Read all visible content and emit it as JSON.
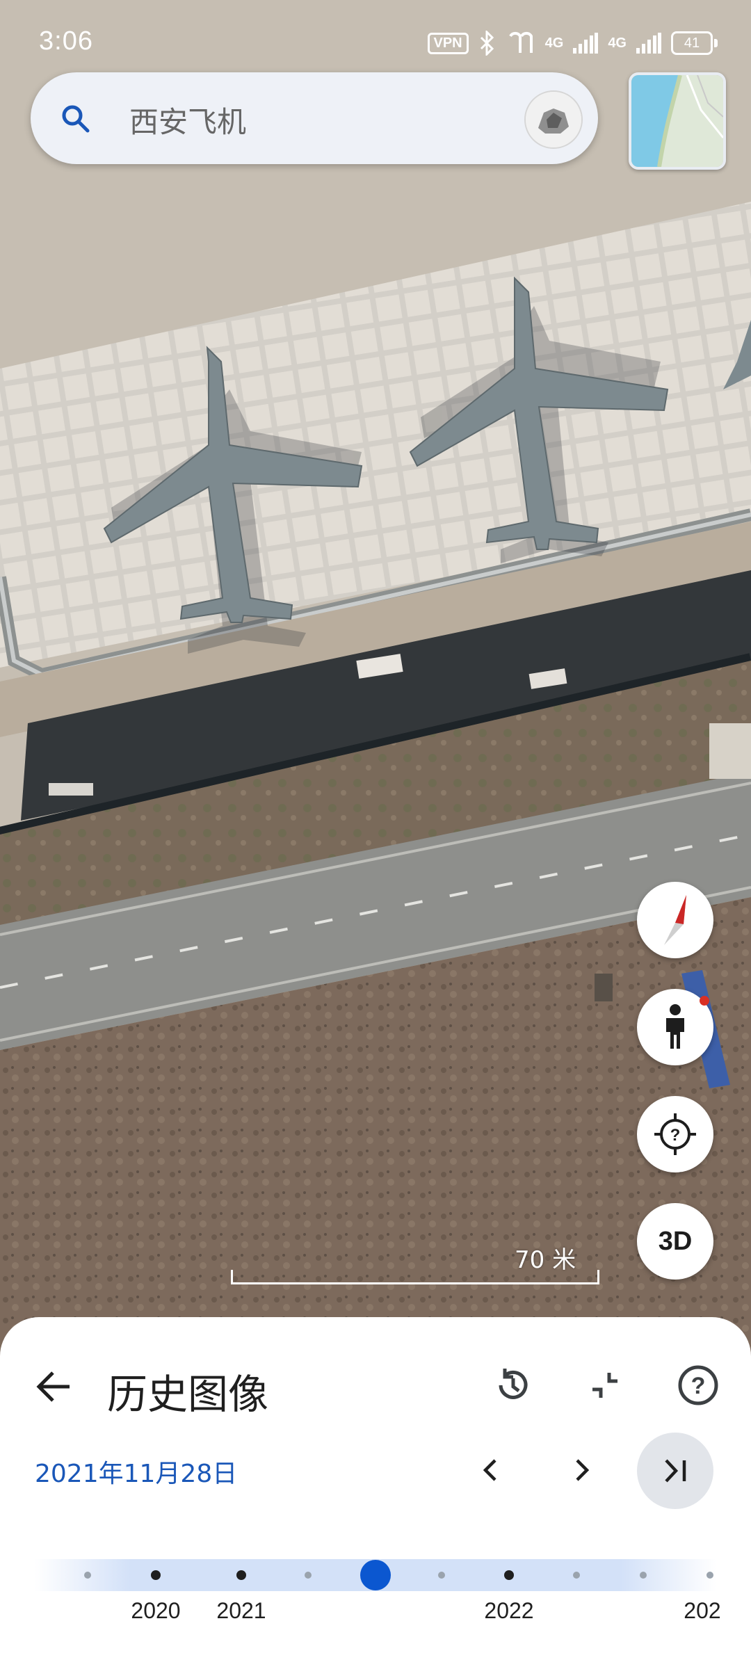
{
  "status_bar": {
    "time": "3:06",
    "vpn": "VPN",
    "network_1": "4G",
    "network_2": "4G",
    "battery": "41"
  },
  "search": {
    "query": "西安飞机"
  },
  "map": {
    "scale_label": "70 米"
  },
  "floating_buttons": {
    "three_d_label": "3D"
  },
  "history_panel": {
    "title": "历史图像",
    "selected_date": "2021年11月28日"
  },
  "timeline": {
    "years": [
      "2020",
      "2021",
      "2022",
      "202"
    ],
    "accent_color": "#0b57d0"
  },
  "icons": {
    "search": "search-icon",
    "compass": "compass-icon",
    "pegman": "pegman-icon",
    "location": "my-location-icon",
    "back": "arrow-back-icon",
    "history": "history-icon",
    "collapse": "collapse-icon",
    "help": "help-icon",
    "prev": "chevron-left-icon",
    "next": "chevron-right-icon",
    "latest": "skip-to-latest-icon"
  }
}
